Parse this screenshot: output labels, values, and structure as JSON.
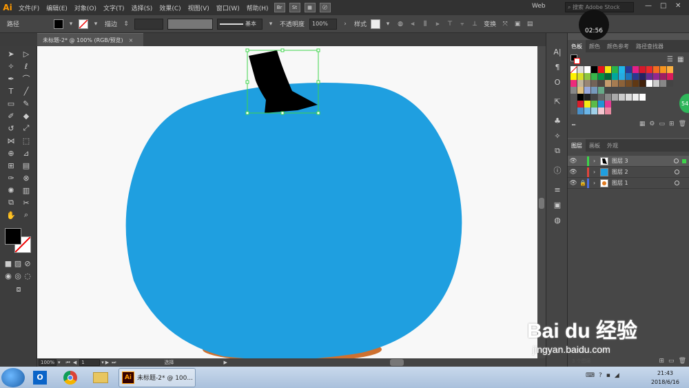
{
  "app": {
    "logo": "Ai",
    "menus": [
      "文件(F)",
      "编辑(E)",
      "对象(O)",
      "文字(T)",
      "选择(S)",
      "效果(C)",
      "视图(V)",
      "窗口(W)",
      "帮助(H)"
    ],
    "menu_icons": [
      "Br",
      "St"
    ],
    "workspace": "Web",
    "stock_placeholder": "搜索 Adobe Stock",
    "timer": "02:56",
    "badge": "54",
    "win_min": "—",
    "win_max": "□",
    "win_close": "✕"
  },
  "control_bar": {
    "selection_label": "路径",
    "stroke_label": "描边",
    "brush_label": "基本",
    "opacity_label": "不透明度",
    "opacity_value": "100%",
    "style_label": "样式",
    "transform_label": "变换"
  },
  "document": {
    "tab_title": "未标题-2* @ 100% (RGB/预览)",
    "close_icon": "×"
  },
  "status": {
    "zoom": "100%",
    "page": "1",
    "tool": "选择"
  },
  "panels": {
    "swatch_tabs": [
      "色板",
      "颜色",
      "颜色参考",
      "路径查找器"
    ],
    "layer_tabs": [
      "图层",
      "画板",
      "外观"
    ],
    "layers": [
      {
        "name": "图层 3",
        "color": "#3dd44a",
        "selected": true,
        "locked": false
      },
      {
        "name": "图层 2",
        "color": "#e0453d",
        "selected": false,
        "locked": false
      },
      {
        "name": "图层 1",
        "color": "#4a6ee0",
        "selected": false,
        "locked": true
      }
    ],
    "layer_count_label": "3 个图层"
  },
  "taskbar": {
    "active_app": "未标题-2* @ 100...",
    "time": "21:43",
    "date": "2018/6/16"
  },
  "watermark": {
    "brand": "Bai du 经验",
    "url": "jingyan.baidu.com"
  },
  "colors": {
    "pumpkin_body": "#1f9fe0",
    "stem": "#000000",
    "selection": "#3dd44a",
    "pumpkin_shadow": "#c9621a"
  }
}
